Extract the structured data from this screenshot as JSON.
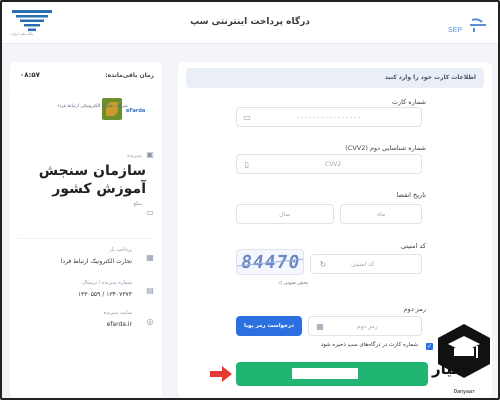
{
  "header": {
    "title": "درگاه پرداخت اینترنتی سپ",
    "sep_logo_text": "SEP",
    "bank_logo_caption": "بانک ملت ایران"
  },
  "timer": {
    "label": "زمان باقی‌مانده:",
    "value": "۰۸:۵۷"
  },
  "merchant": {
    "brand": "eFarda",
    "company_name": "شرکت تجارت الکترونیکی ارتباط فردا",
    "acceptor_label": "پذیرنده",
    "acceptor_value": "سازمان سنجش آموزش کشور",
    "amount_label": "مبلغ",
    "acceptor_type_label": "پرداخت یار",
    "acceptor_type_value": "تجارت الکترونیک ارتباط فردا",
    "terminal_label": "شماره پذیرنده / ترمینال",
    "terminal_value": "۱۳۴۰۷۳۷۳ / ۱۳۳۰۵۵۹",
    "website_label": "سایت پذیرنده",
    "website_value": "efarda.ir"
  },
  "form": {
    "section_title": "اطلاعات کارت خود را وارد کنید",
    "card_number_label": "شماره کارت",
    "card_number_placeholder": "- - - -   - - - -   - - - -   - - - -",
    "cvv2_label": "شماره شناسایی دوم (CVV2)",
    "cvv2_placeholder": "CVV2",
    "expiry_label": "تاریخ انقضا",
    "month_placeholder": "ماه",
    "year_placeholder": "سال",
    "captcha_label": "کد امنیتی",
    "captcha_placeholder": "کد امنیتی",
    "captcha_value": "84470",
    "audio_label": "پخش صوتی",
    "password_label": "رمز دوم",
    "password_placeholder": "رمز دوم",
    "otp_button": "درخواست رمز پویا",
    "save_card_label": "شماره کارت در درگاه‌های سپ ذخیره شود"
  },
  "watermark": {
    "text": "دانیار",
    "sub": "Danyaar"
  },
  "colors": {
    "primary": "#2b6fe0",
    "pay": "#20b573",
    "arrow": "#e53935"
  }
}
